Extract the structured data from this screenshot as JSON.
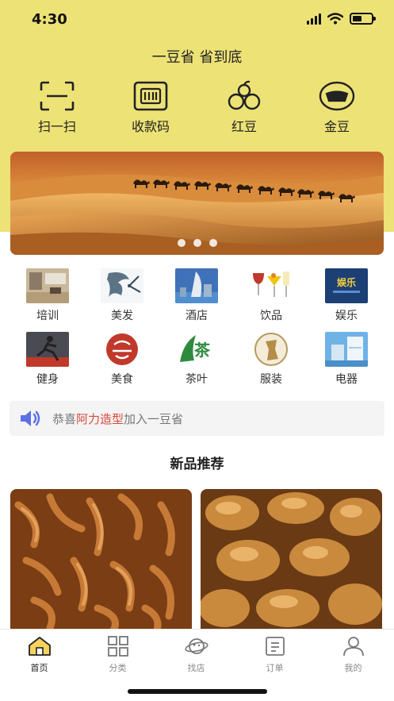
{
  "status_bar": {
    "time": "4:30",
    "battery_level": 0.5
  },
  "header": {
    "title": "一豆省 省到底"
  },
  "quick_actions": [
    {
      "label": "扫一扫",
      "icon": "scan-icon"
    },
    {
      "label": "收款码",
      "icon": "barcode-icon"
    },
    {
      "label": "红豆",
      "icon": "red-bean-icon"
    },
    {
      "label": "金豆",
      "icon": "gold-ingot-icon"
    }
  ],
  "banner": {
    "image": "desert-camel-caravan-photo",
    "slide_count": 3
  },
  "categories": [
    {
      "label": "培训",
      "icon": "training-room-thumbnail"
    },
    {
      "label": "美发",
      "icon": "hair-salon-thumbnail"
    },
    {
      "label": "酒店",
      "icon": "hotel-thumbnail"
    },
    {
      "label": "饮品",
      "icon": "drinks-thumbnail"
    },
    {
      "label": "娱乐",
      "icon": "entertainment-thumbnail"
    },
    {
      "label": "健身",
      "icon": "fitness-thumbnail"
    },
    {
      "label": "美食",
      "icon": "food-thumbnail"
    },
    {
      "label": "茶叶",
      "icon": "tea-thumbnail"
    },
    {
      "label": "服装",
      "icon": "clothing-thumbnail"
    },
    {
      "label": "电器",
      "icon": "appliance-thumbnail"
    }
  ],
  "notice": {
    "prefix": "恭喜",
    "highlight": "阿力造型",
    "suffix": "加入一豆省"
  },
  "new_products": {
    "title": "新品推荐",
    "items": [
      {
        "image": "braised-chicken-feet-photo"
      },
      {
        "image": "braised-chicken-legs-photo"
      }
    ]
  },
  "tabbar": [
    {
      "label": "首页",
      "icon": "home-icon",
      "active": true
    },
    {
      "label": "分类",
      "icon": "grid-icon",
      "active": false
    },
    {
      "label": "找店",
      "icon": "planet-icon",
      "active": false
    },
    {
      "label": "订单",
      "icon": "order-icon",
      "active": false
    },
    {
      "label": "我的",
      "icon": "user-icon",
      "active": false
    }
  ],
  "colors": {
    "header_yellow": "#ede276",
    "highlight_red": "#d84a3a",
    "speaker_blue": "#5b6fe6"
  }
}
